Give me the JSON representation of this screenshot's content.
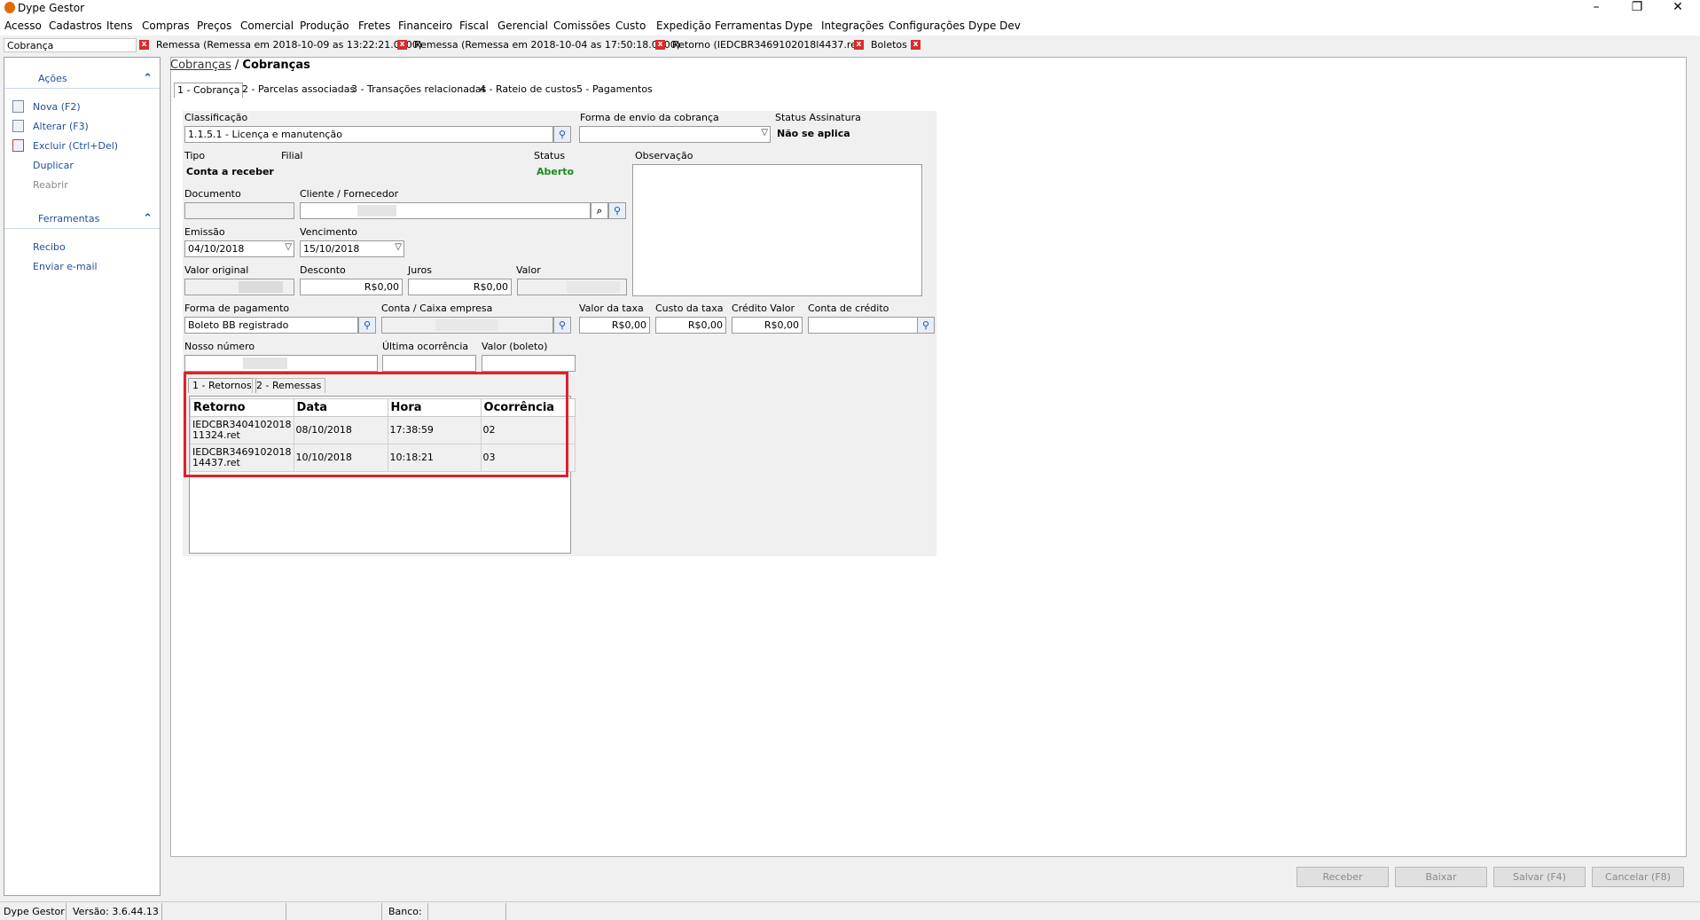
{
  "window": {
    "title": "Dype Gestor",
    "minimize": "–",
    "restore": "❐",
    "close": "✕"
  },
  "menu": [
    "Acesso",
    "Cadastros",
    "Itens",
    "Compras",
    "Preços",
    "Comercial",
    "Produção",
    "Fretes",
    "Financeiro",
    "Fiscal",
    "Gerencial",
    "Comissões",
    "Custo",
    "Expedição",
    "Ferramentas",
    "Dype",
    "Integrações",
    "Configurações",
    "Dype Dev"
  ],
  "doc_tabs": {
    "search_value": "Cobrança",
    "tabs": [
      "Remessa (Remessa em 2018-10-09 as 13:22:21.0000)",
      "Remessa (Remessa em 2018-10-04 as 17:50:18.0000)",
      "Retorno (IEDCBR3469102018l4437.ret)",
      "Boletos"
    ]
  },
  "sidebar": {
    "actions_title": "Ações",
    "actions": [
      {
        "label": "Nova (F2)",
        "icon": "new-document-icon"
      },
      {
        "label": "Alterar (F3)",
        "icon": "edit-document-icon"
      },
      {
        "label": "Excluir (Ctrl+Del)",
        "icon": "delete-document-icon"
      },
      {
        "label": "Duplicar"
      },
      {
        "label": "Reabrir"
      }
    ],
    "tools_title": "Ferramentas",
    "tools": [
      "Recibo",
      "Enviar e-mail"
    ]
  },
  "breadcrumb": {
    "link": "Cobranças",
    "sep": "/",
    "current": "Cobranças"
  },
  "main_tabs": [
    "1 - Cobrança",
    "2 - Parcelas associadas",
    "3 - Transações relacionadas",
    "4 - Rateio de custos",
    "5 - Pagamentos"
  ],
  "form": {
    "classificacao_label": "Classificação",
    "classificacao": "1.1.5.1 - Licença e manutenção",
    "forma_envio_label": "Forma de envio da cobrança",
    "forma_envio": "",
    "status_assinatura_label": "Status Assinatura",
    "status_assinatura": "Não se aplica",
    "tipo_label": "Tipo",
    "tipo": "Conta a receber",
    "filial_label": "Filial",
    "status_label": "Status",
    "status": "Aberto",
    "observacao_label": "Observação",
    "documento_label": "Documento",
    "cliente_label": "Cliente / Fornecedor",
    "emissao_label": "Emissão",
    "emissao": "04/10/2018",
    "vencimento_label": "Vencimento",
    "vencimento": "15/10/2018",
    "valor_original_label": "Valor original",
    "desconto_label": "Desconto",
    "desconto": "R$0,00",
    "juros_label": "Juros",
    "juros": "R$0,00",
    "valor_label": "Valor",
    "forma_pagamento_label": "Forma de pagamento",
    "forma_pagamento": "Boleto BB registrado",
    "conta_caixa_label": "Conta / Caixa empresa",
    "valor_taxa_label": "Valor da taxa",
    "valor_taxa": "R$0,00",
    "custo_taxa_label": "Custo da taxa",
    "custo_taxa": "R$0,00",
    "credito_valor_label": "Crédito Valor",
    "credito_valor": "R$0,00",
    "conta_credito_label": "Conta de crédito",
    "nosso_numero_label": "Nosso número",
    "ultima_ocorrencia_label": "Última ocorrência",
    "valor_boleto_label": "Valor (boleto)"
  },
  "sub_tabs": [
    "1 - Retornos",
    "2 - Remessas"
  ],
  "retornos_table": {
    "headers": [
      "Retorno",
      "Data",
      "Hora",
      "Ocorrência"
    ],
    "rows": [
      {
        "retorno_line1": "IEDCBR3404102018",
        "retorno_line2": "11324.ret",
        "data": "08/10/2018",
        "hora": "17:38:59",
        "ocorrencia": "02"
      },
      {
        "retorno_line1": "IEDCBR3469102018",
        "retorno_line2": "14437.ret",
        "data": "10/10/2018",
        "hora": "10:18:21",
        "ocorrencia": "03"
      }
    ]
  },
  "buttons": {
    "receber": "Receber",
    "baixar": "Baixar",
    "salvar": "Salvar (F4)",
    "cancelar": "Cancelar (F8)"
  },
  "statusbar": {
    "app": "Dype Gestor",
    "versao": "Versão: 3.6.44.13",
    "banco": "Banco:"
  },
  "colors": {
    "highlight": "#e0202a",
    "status_open": "#1a8a1a",
    "link": "#1f4f9a"
  }
}
